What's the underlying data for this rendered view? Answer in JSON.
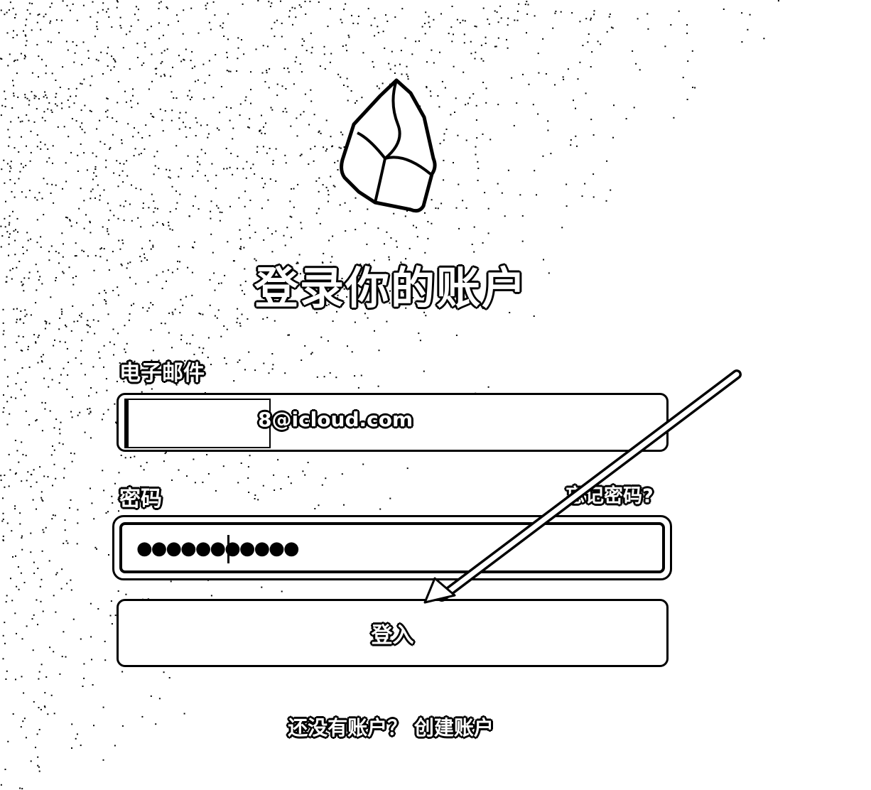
{
  "page": {
    "title": "登录你的账户",
    "logo_icon": "obsidian-logo-icon"
  },
  "email": {
    "label": "电子邮件",
    "value": "8@icloud.com"
  },
  "password": {
    "label": "密码",
    "value": "●●●●●●●●●●●",
    "forgot_link": "忘记密码?"
  },
  "login_button": {
    "label": "登入"
  },
  "signup": {
    "prompt": "还没有账户？",
    "link": "创建账户"
  }
}
